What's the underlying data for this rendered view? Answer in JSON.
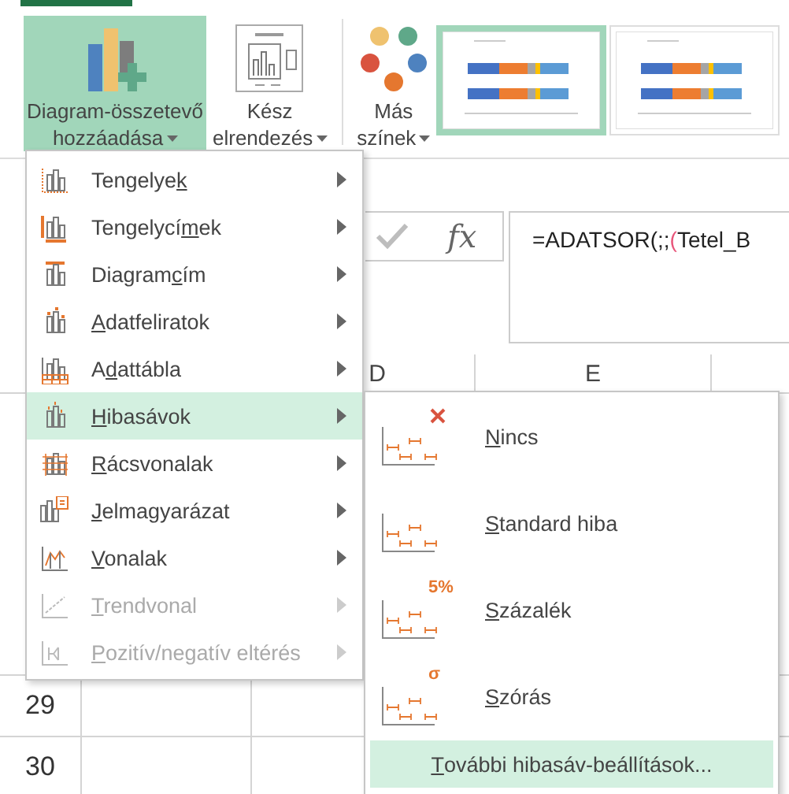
{
  "ribbon": {
    "buttons": [
      {
        "kind": "elements",
        "lines": [
          "Diagram-összetevő",
          "hozzáadása"
        ],
        "selected": true
      },
      {
        "kind": "layout",
        "lines": [
          "Kész",
          "elrendezés"
        ],
        "selected": false
      },
      {
        "kind": "colors",
        "lines": [
          "Más",
          "színek"
        ],
        "selected": false
      }
    ],
    "styles": [
      {
        "selected": true
      },
      {
        "selected": false
      }
    ]
  },
  "formula_bar": {
    "fx": "fx",
    "formula": [
      {
        "text": "=ADATSOR(;;"
      },
      {
        "text": "(",
        "color": "#e8557a"
      },
      {
        "text": "Tetel_B"
      }
    ]
  },
  "columns": [
    "D",
    "E"
  ],
  "rows": [
    "29",
    "30"
  ],
  "menu": {
    "items": [
      {
        "before": "Tengelye",
        "key": "k",
        "disabled": false,
        "selected": false
      },
      {
        "before": "Tengelycí",
        "key": "m",
        "after": "ek",
        "disabled": false,
        "selected": false
      },
      {
        "before": "Diagram",
        "key": "c",
        "after": "ím",
        "disabled": false,
        "selected": false
      },
      {
        "key": "A",
        "after": "datfeliratok",
        "disabled": false,
        "selected": false
      },
      {
        "before": "A",
        "key": "d",
        "after": "attábla",
        "disabled": false,
        "selected": false
      },
      {
        "key": "H",
        "after": "ibasávok",
        "disabled": false,
        "selected": true
      },
      {
        "key": "R",
        "after": "ácsvonalak",
        "disabled": false,
        "selected": false
      },
      {
        "key": "J",
        "after": "elmagyarázat",
        "disabled": false,
        "selected": false
      },
      {
        "key": "V",
        "after": "onalak",
        "disabled": false,
        "selected": false
      },
      {
        "key": "T",
        "after": "rendvonal",
        "disabled": true,
        "selected": false
      },
      {
        "key": "P",
        "after": "ozitív/negatív eltérés",
        "disabled": true,
        "selected": false
      }
    ]
  },
  "submenu": {
    "items": [
      {
        "kind": "none",
        "key": "N",
        "after": "incs"
      },
      {
        "kind": "standard",
        "key": "S",
        "after": "tandard hiba"
      },
      {
        "kind": "percent",
        "badge": "5%",
        "key": "S",
        "after": "zázalék"
      },
      {
        "kind": "stdev",
        "badge": "σ",
        "key": "S",
        "after": "zórás"
      }
    ],
    "footer": {
      "key": "T",
      "after": "ovábbi hibasáv-beállítások...",
      "selected": true
    }
  }
}
